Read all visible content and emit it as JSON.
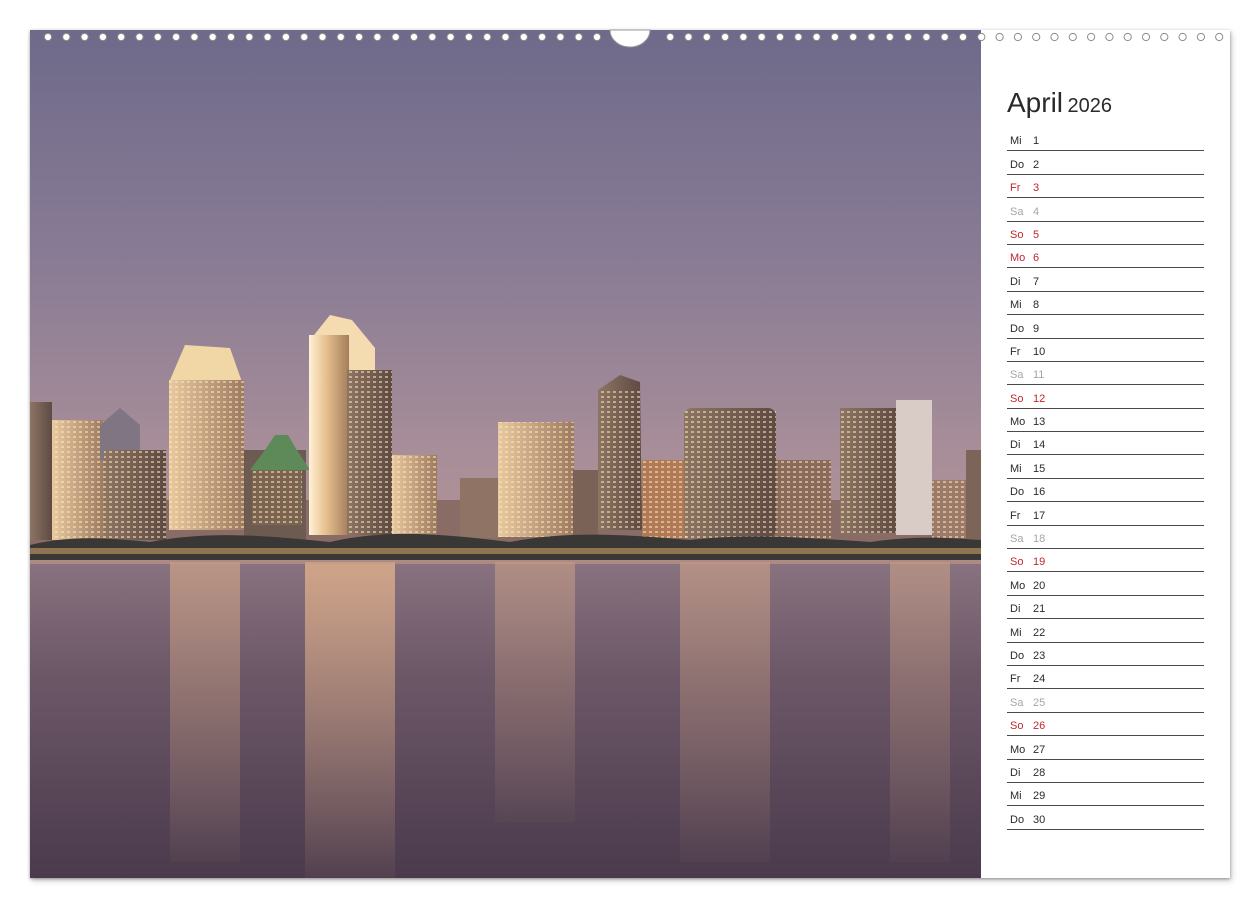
{
  "calendar": {
    "month": "April",
    "year": "2026",
    "days": [
      {
        "weekday": "Mi",
        "day": "1",
        "type": "normal"
      },
      {
        "weekday": "Do",
        "day": "2",
        "type": "normal"
      },
      {
        "weekday": "Fr",
        "day": "3",
        "type": "holiday"
      },
      {
        "weekday": "Sa",
        "day": "4",
        "type": "saturday"
      },
      {
        "weekday": "So",
        "day": "5",
        "type": "holiday"
      },
      {
        "weekday": "Mo",
        "day": "6",
        "type": "holiday"
      },
      {
        "weekday": "Di",
        "day": "7",
        "type": "normal"
      },
      {
        "weekday": "Mi",
        "day": "8",
        "type": "normal"
      },
      {
        "weekday": "Do",
        "day": "9",
        "type": "normal"
      },
      {
        "weekday": "Fr",
        "day": "10",
        "type": "normal"
      },
      {
        "weekday": "Sa",
        "day": "11",
        "type": "saturday"
      },
      {
        "weekday": "So",
        "day": "12",
        "type": "holiday"
      },
      {
        "weekday": "Mo",
        "day": "13",
        "type": "normal"
      },
      {
        "weekday": "Di",
        "day": "14",
        "type": "normal"
      },
      {
        "weekday": "Mi",
        "day": "15",
        "type": "normal"
      },
      {
        "weekday": "Do",
        "day": "16",
        "type": "normal"
      },
      {
        "weekday": "Fr",
        "day": "17",
        "type": "normal"
      },
      {
        "weekday": "Sa",
        "day": "18",
        "type": "saturday"
      },
      {
        "weekday": "So",
        "day": "19",
        "type": "holiday"
      },
      {
        "weekday": "Mo",
        "day": "20",
        "type": "normal"
      },
      {
        "weekday": "Di",
        "day": "21",
        "type": "normal"
      },
      {
        "weekday": "Mi",
        "day": "22",
        "type": "normal"
      },
      {
        "weekday": "Do",
        "day": "23",
        "type": "normal"
      },
      {
        "weekday": "Fr",
        "day": "24",
        "type": "normal"
      },
      {
        "weekday": "Sa",
        "day": "25",
        "type": "saturday"
      },
      {
        "weekday": "So",
        "day": "26",
        "type": "holiday"
      },
      {
        "weekday": "Mo",
        "day": "27",
        "type": "normal"
      },
      {
        "weekday": "Di",
        "day": "28",
        "type": "normal"
      },
      {
        "weekday": "Mi",
        "day": "29",
        "type": "normal"
      },
      {
        "weekday": "Do",
        "day": "30",
        "type": "normal"
      }
    ]
  },
  "colors": {
    "text": "#2a2a2a",
    "holiday": "#c0272d",
    "saturday": "#a6a6a6",
    "rule": "#4a4a4a"
  }
}
